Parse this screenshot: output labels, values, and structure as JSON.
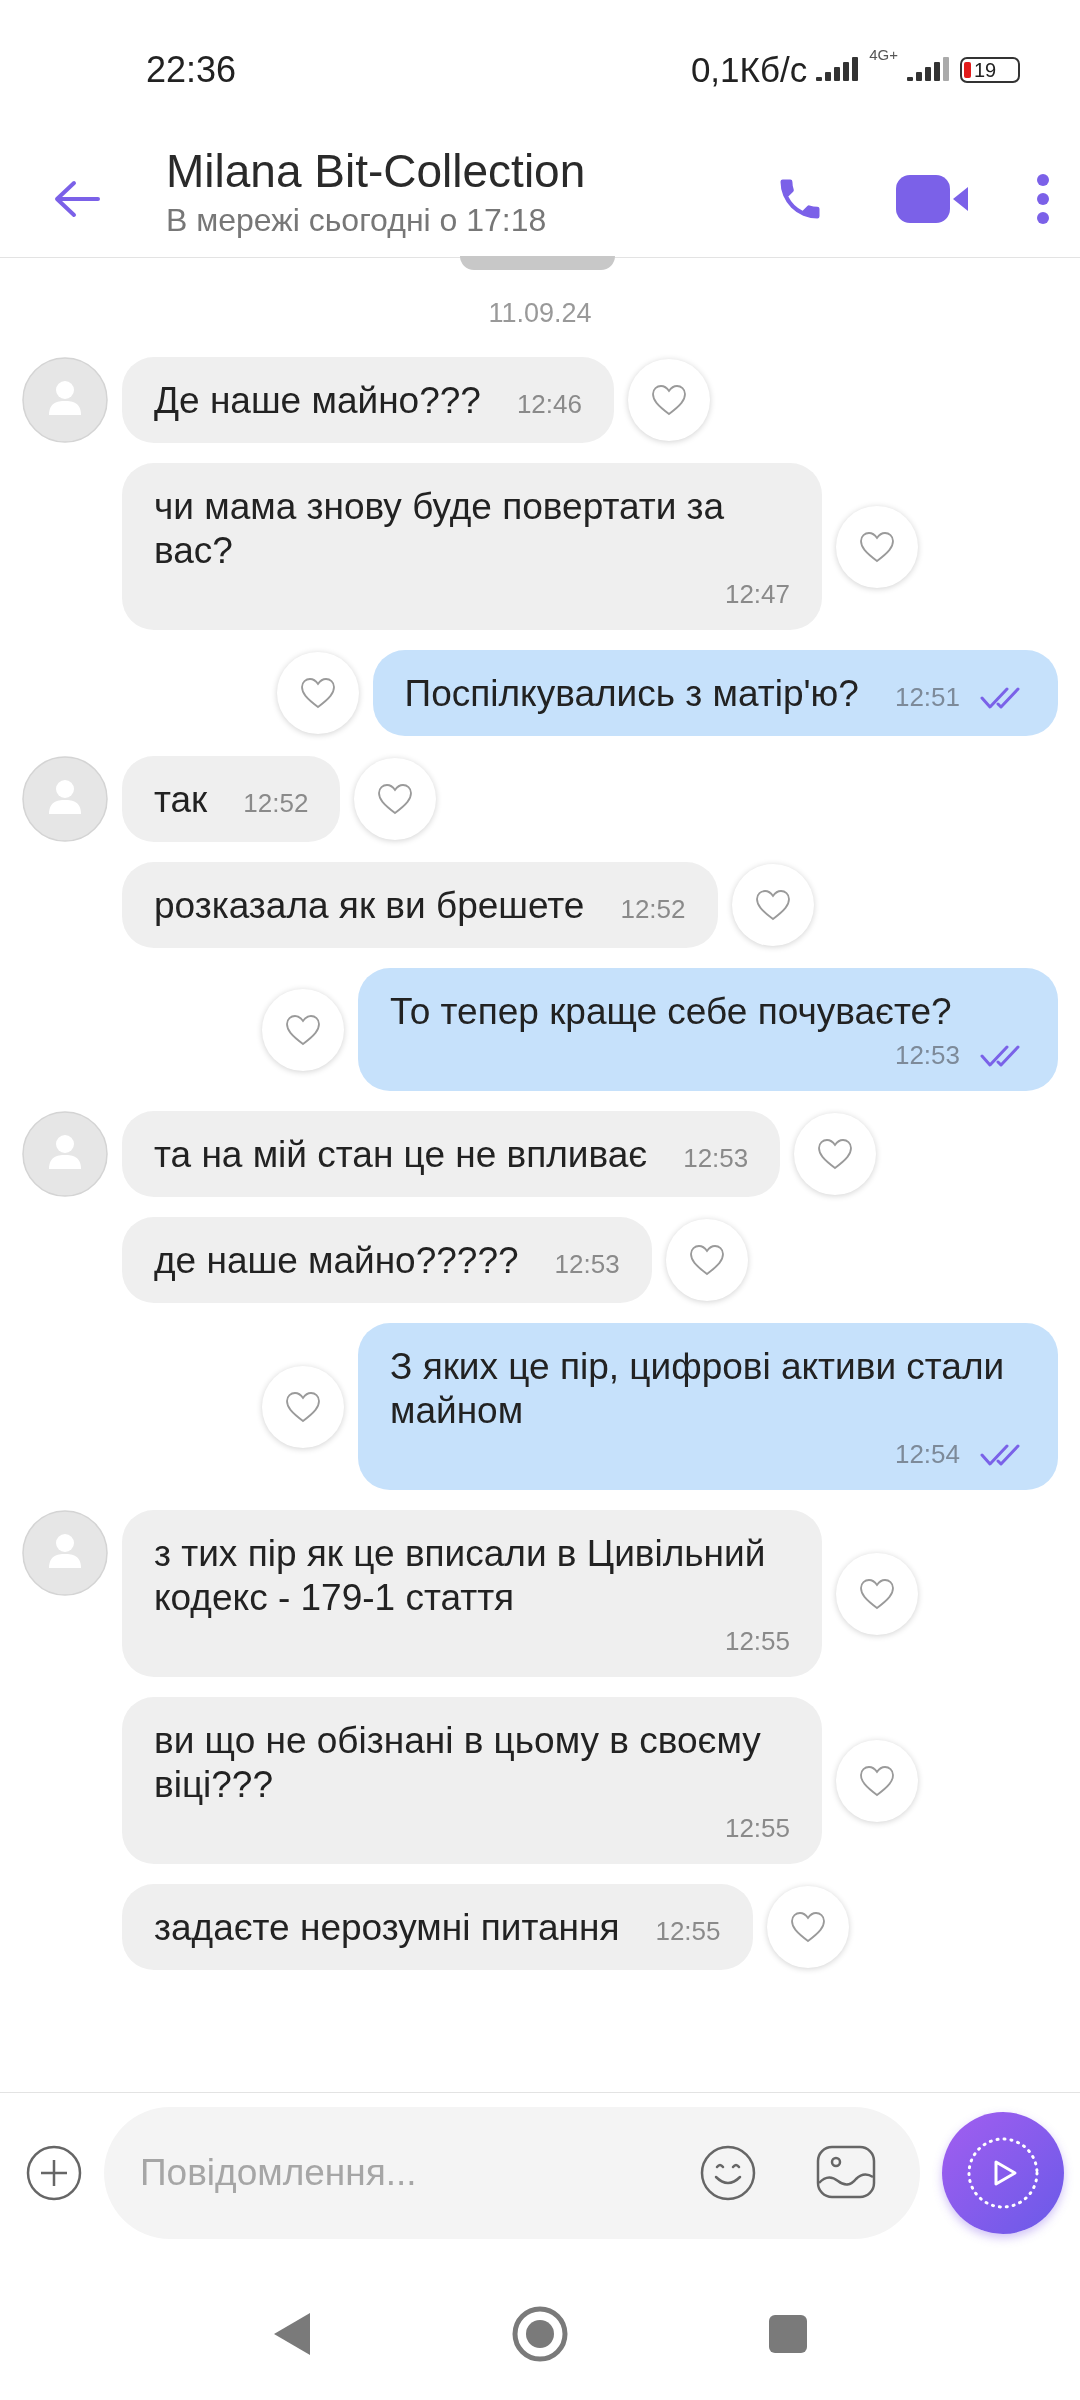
{
  "status_bar": {
    "time": "22:36",
    "speed": "0,1Кб/с",
    "network": "4G+",
    "battery": "19"
  },
  "header": {
    "title": "Milana Bit-Collection",
    "subtitle": "В мережі сьогодні о 17:18"
  },
  "date_label": "11.09.24",
  "messages": [
    {
      "kind": "incoming",
      "avatar": true,
      "text": "Де наше майно???",
      "time": "12:46"
    },
    {
      "kind": "incoming",
      "avatar": false,
      "text": "чи мама знову буде повертати за вас?",
      "time": "12:47"
    },
    {
      "kind": "outgoing",
      "text": "Поспілкувались з матір'ю?",
      "time": "12:51",
      "read": true
    },
    {
      "kind": "incoming",
      "avatar": true,
      "text": "так",
      "time": "12:52"
    },
    {
      "kind": "incoming",
      "avatar": false,
      "text": "розказала як ви брешете",
      "time": "12:52"
    },
    {
      "kind": "outgoing",
      "text": "То тепер краще себе почуваєте?",
      "time": "12:53",
      "read": true
    },
    {
      "kind": "incoming",
      "avatar": true,
      "text": "та на мій стан це не впливає",
      "time": "12:53"
    },
    {
      "kind": "incoming",
      "avatar": false,
      "text": "де наше майно?????",
      "time": "12:53"
    },
    {
      "kind": "outgoing",
      "text": "З яких це пір, цифрові активи стали майном",
      "time": "12:54",
      "read": true
    },
    {
      "kind": "incoming",
      "avatar": true,
      "text": "з тих пір як це вписали в Цивільний кодекс - 179-1 стаття",
      "time": "12:55"
    },
    {
      "kind": "incoming",
      "avatar": false,
      "text": "ви що не обізнані в цьому в своєму віці???",
      "time": "12:55"
    },
    {
      "kind": "incoming",
      "avatar": false,
      "text": "задаєте нерозумні питання",
      "time": "12:55"
    }
  ],
  "composer": {
    "placeholder": "Повідомлення..."
  }
}
